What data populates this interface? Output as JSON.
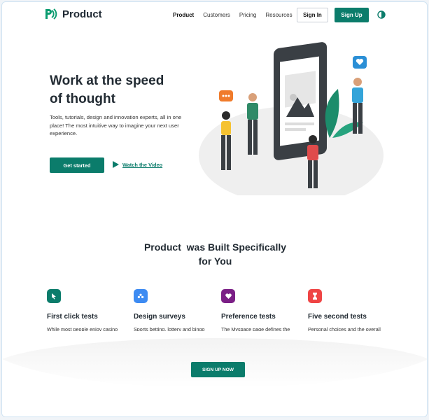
{
  "nav": {
    "logo_text": "Product",
    "links": [
      "Product",
      "Customers",
      "Pricing",
      "Resources"
    ],
    "signin_label": "Sign In",
    "signup_label": "Sign Up"
  },
  "hero": {
    "title_line1": "Work at the speed",
    "title_line2": "of thought",
    "description": "Tools, tutorials, design and innovation experts, all in one place! The most intuitive way to imagine your next user experience.",
    "cta_label": "Get started",
    "video_label": "Watch the Video"
  },
  "features": {
    "title_line1": "Product  was Built Specifically",
    "title_line2": "for You",
    "items": [
      {
        "title": "First click tests",
        "desc": "While most people enjoy casino gambling,",
        "color": "#0b7c6b",
        "icon": "cursor-icon"
      },
      {
        "title": "Design surveys",
        "desc": "Sports betting, lottery and bingo playing for the fun",
        "color": "#3d8bf2",
        "icon": "users-icon"
      },
      {
        "title": "Preference tests",
        "desc": "The Myspace page defines the individual.",
        "color": "#7b1f86",
        "icon": "heart-icon"
      },
      {
        "title": "Five second tests",
        "desc": "Personal choices and the overall personality of the person.",
        "color": "#ef4444",
        "icon": "hourglass-icon"
      }
    ],
    "cta_label": "SIGN UP NOW"
  },
  "colors": {
    "accent": "#0b7c6b",
    "text": "#222b33"
  }
}
